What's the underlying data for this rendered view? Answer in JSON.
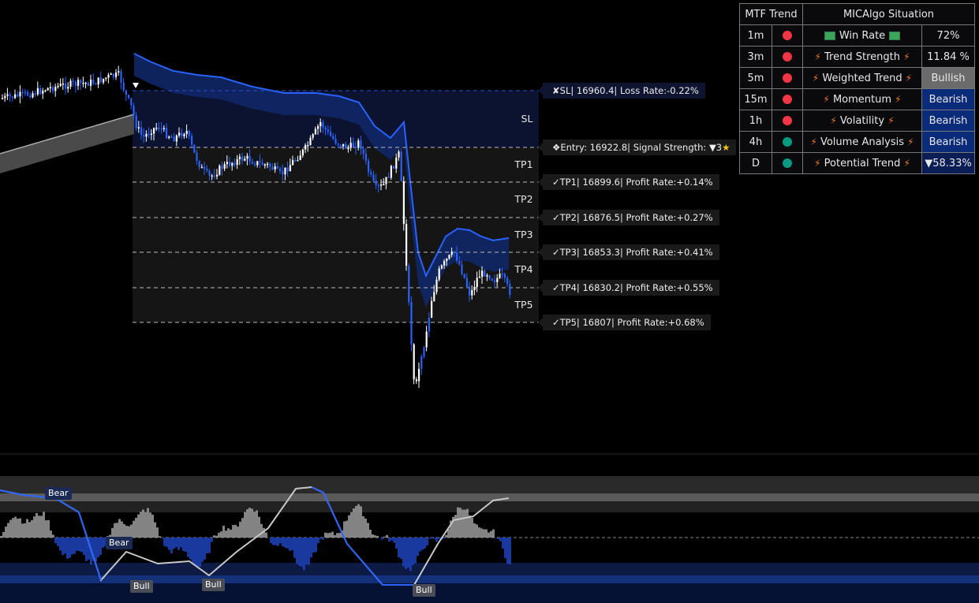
{
  "colors": {
    "bull": "#ffffff",
    "bear": "#2962ff",
    "sl_zone": "#0b1330",
    "tp_zone": "#151515",
    "red_dot": "#f23645",
    "green_dot": "#089981"
  },
  "levels": [
    {
      "tag": "SL",
      "label": "SL| 16960.4| Loss Rate:-0.22%",
      "icon": "x-icon",
      "glyph": "✘"
    },
    {
      "tag": "",
      "label": "Entry: 16922.8| Signal Strength: ▼3",
      "icon": "entry-icon",
      "glyph": "❖"
    },
    {
      "tag": "TP1",
      "label": "TP1| 16899.6| Profit Rate:+0.14%",
      "icon": "check-icon",
      "glyph": "✓"
    },
    {
      "tag": "TP2",
      "label": "TP2| 16876.5| Profit Rate:+0.27%",
      "icon": "check-icon",
      "glyph": "✓"
    },
    {
      "tag": "TP3",
      "label": "TP3| 16853.3| Profit Rate:+0.41%",
      "icon": "check-icon",
      "glyph": "✓"
    },
    {
      "tag": "TP4",
      "label": "TP4| 16830.2| Profit Rate:+0.55%",
      "icon": "check-icon",
      "glyph": "✓"
    },
    {
      "tag": "TP5",
      "label": "TP5| 16807| Profit Rate:+0.68%",
      "icon": "check-icon",
      "glyph": "✓"
    }
  ],
  "oscillator_tags": [
    "Bear",
    "Bear",
    "Bull",
    "Bull",
    "Bull"
  ],
  "table": {
    "header_left": "MTF Trend",
    "header_right": "MICAlgo Situation",
    "rows": [
      {
        "tf": "1m",
        "trend": "bear",
        "metric": "Win Rate",
        "icon": "cash-icon",
        "value": "72%",
        "style": "plain"
      },
      {
        "tf": "3m",
        "trend": "bear",
        "metric": "Trend Strength",
        "icon": "bolt-icon",
        "value": "11.84 %",
        "style": "plain"
      },
      {
        "tf": "5m",
        "trend": "bear",
        "metric": "Weighted Trend",
        "icon": "bolt-icon",
        "value": "Bullish",
        "style": "bull"
      },
      {
        "tf": "15m",
        "trend": "bear",
        "metric": "Momentum",
        "icon": "bolt-icon",
        "value": "Bearish",
        "style": "bear"
      },
      {
        "tf": "1h",
        "trend": "bear",
        "metric": "Volatility",
        "icon": "bolt-icon",
        "value": "Bearish",
        "style": "bear"
      },
      {
        "tf": "4h",
        "trend": "bull",
        "metric": "Volume Analysis",
        "icon": "bolt-icon",
        "value": "Bearish",
        "style": "bear"
      },
      {
        "tf": "D",
        "trend": "bull",
        "metric": "Potential Trend",
        "icon": "bolt-icon",
        "value": "▼58.33%",
        "style": "pot"
      }
    ]
  }
}
